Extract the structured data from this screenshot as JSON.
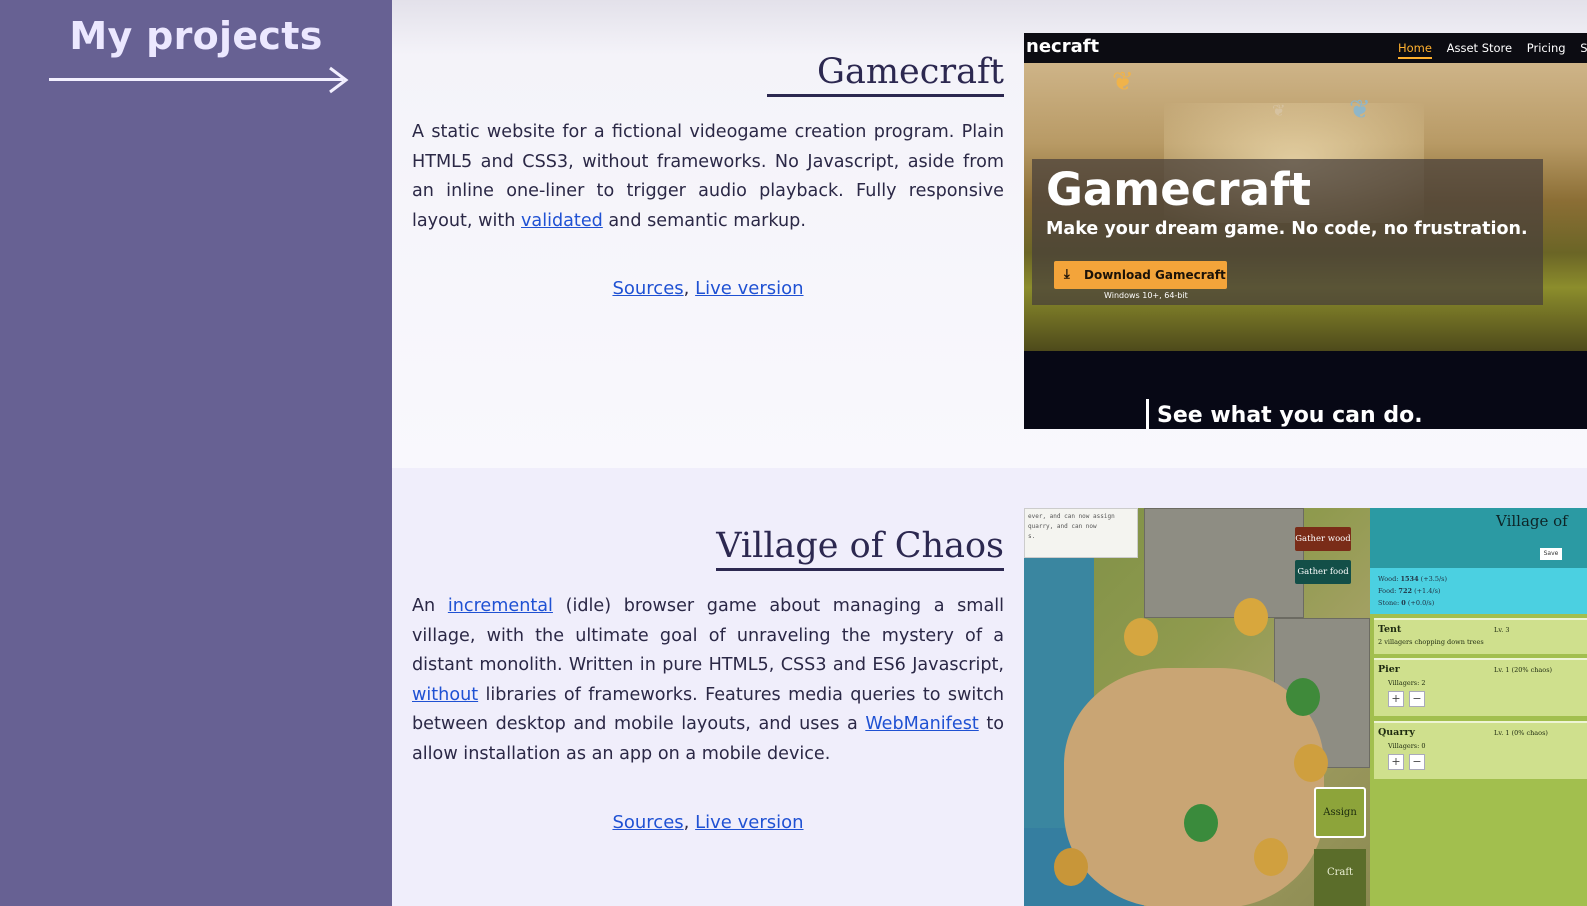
{
  "sidebar": {
    "heading": "My projects"
  },
  "projects": [
    {
      "title": "Gamecraft",
      "desc_1": "A static website for a fictional videogame creation program. Plain HTML5 and CSS3, without frameworks. No Javascript, aside from an inline one-liner to trigger audio playback. Fully responsive layout, with ",
      "link_1": "validated",
      "desc_2": " and semantic markup.",
      "sources": "Sources",
      "separator": ",",
      "live": "Live version",
      "screenshot": {
        "logo": "necraft",
        "nav": [
          "Home",
          "Asset Store",
          "Pricing",
          "S"
        ],
        "hero_title": "Gamecraft",
        "hero_subtitle": "Make your dream game. No code, no frustration.",
        "download_button": "Download Gamecraft",
        "download_note": "Windows 10+, 64-bit",
        "tagline": "See what you can do."
      }
    },
    {
      "title": "Village of Chaos",
      "desc_1": "An ",
      "link_1": "incremental",
      "desc_2": " (idle) browser game about managing a small village, with the ultimate goal of unraveling the mystery of a distant monolith. Written in pure HTML5, CSS3 and ES6 Javascript, ",
      "link_2": "without",
      "desc_3": " libraries of frameworks. Features media queries to switch between desktop and mobile layouts, and uses a ",
      "link_3": "WebManifest",
      "desc_4": " to allow installation as an app on a mobile device.",
      "sources": "Sources",
      "separator": ",",
      "live": "Live version",
      "screenshot": {
        "log_line_1": "ever, and can now assign",
        "log_line_2": "quarry, and can now",
        "log_line_3": "s.",
        "gather_wood": "Gather wood",
        "gather_food": "Gather food",
        "assign": "Assign",
        "craft": "Craft",
        "panel_title": "Village of",
        "save": "Save",
        "resources": [
          {
            "name": "Wood:",
            "value": "1534",
            "rate": "(+3.5/s)"
          },
          {
            "name": "Food:",
            "value": "722",
            "rate": "(+1.4/s)"
          },
          {
            "name": "Stone:",
            "value": "0",
            "rate": "(+0.0/s)"
          }
        ],
        "buildings": [
          {
            "name": "Tent",
            "level": "Lv. 3",
            "detail": "2 villagers chopping down trees"
          },
          {
            "name": "Pier",
            "level": "Lv. 1 (20% chaos)",
            "detail": "Villagers: 2",
            "plus": "+",
            "minus": "−"
          },
          {
            "name": "Quarry",
            "level": "Lv. 1 (0% chaos)",
            "detail": "Villagers: 0",
            "plus": "+",
            "minus": "−"
          }
        ]
      }
    }
  ]
}
